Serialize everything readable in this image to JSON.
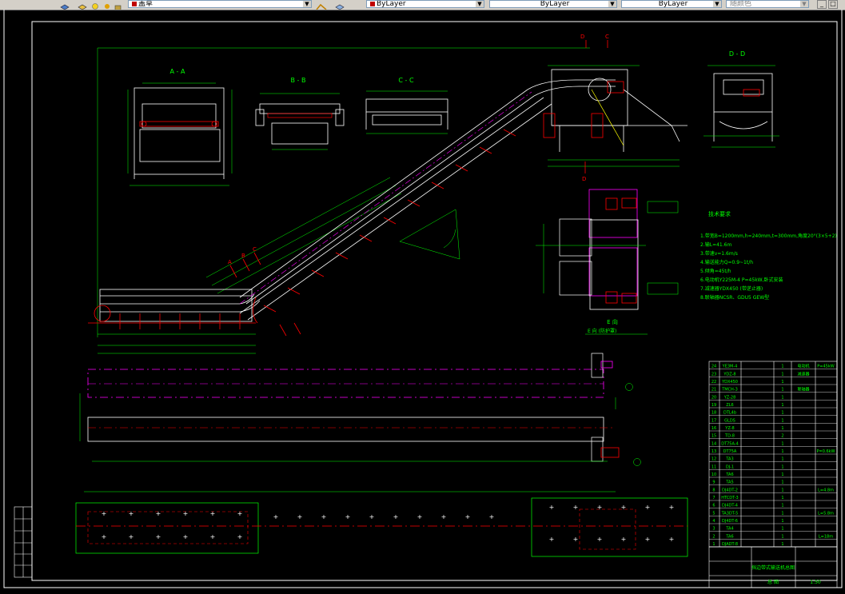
{
  "toolbar": {
    "layer_combo": "盖草",
    "color_combo": "ByLayer",
    "linetype_combo": "ByLayer",
    "lineweight_combo": "ByLayer",
    "plotstyle_combo": "随颜色"
  },
  "drawing": {
    "section_labels": {
      "aa": "A - A",
      "bb": "B - B",
      "cc": "C - C",
      "dd": "D - D",
      "e": "E 向"
    },
    "section_markers": [
      "D",
      "C",
      "D",
      "C",
      "A",
      "B",
      "C"
    ],
    "tech_title": "技术要求",
    "tech_notes": [
      "1.带宽B=1200mm,h=240mm,t=300mm,角度20°(3×5+2)",
      "2.输L=41.6m",
      "3.带速v=1.6m/s",
      "4.输送能力Q=0.9~1t/h",
      "5.倾角=45t/h",
      "6.电动机Y225M-4 P=45kW,卧式安装",
      "7.减速器YDX450 (带逆止器)",
      "8.联轴器NCSR、GDU5 GEW型"
    ],
    "e_note": "E 向 (防护罩)",
    "bom_rows": [
      [
        "24",
        "YE3M-4",
        "1",
        "电动机",
        "P=45kW"
      ],
      [
        "23",
        "YDZ-8",
        "1",
        "减速器",
        ""
      ],
      [
        "22",
        "YDX450",
        "1",
        "",
        ""
      ],
      [
        "21",
        "TMCH-3",
        "1",
        "联轴器",
        ""
      ],
      [
        "20",
        "YZ-28",
        "1",
        "",
        ""
      ],
      [
        "19",
        "ZL6",
        "1",
        "",
        ""
      ],
      [
        "18",
        "DTL4b",
        "1",
        "",
        ""
      ],
      [
        "17",
        "GLDS",
        "1",
        "",
        ""
      ],
      [
        "16",
        "YZ-8",
        "1",
        "",
        ""
      ],
      [
        "15",
        "TD-8",
        "2",
        "",
        ""
      ],
      [
        "14",
        "DT75A-4",
        "1",
        "",
        ""
      ],
      [
        "13",
        "DT75A",
        "1",
        "",
        "P=0.6kW"
      ],
      [
        "12",
        "TA3",
        "1",
        "",
        ""
      ],
      [
        "11",
        "DJ-1",
        "1",
        "",
        ""
      ],
      [
        "10",
        "TA6",
        "1",
        "",
        ""
      ],
      [
        "9",
        "TA5",
        "1",
        "",
        ""
      ],
      [
        "8",
        "DJ4DT-2",
        "1",
        "",
        "L=4.8m"
      ],
      [
        "7",
        "HTCDT-3",
        "1",
        "",
        ""
      ],
      [
        "6",
        "DJ4DT-4",
        "1",
        "",
        ""
      ],
      [
        "5",
        "TA3DT-5",
        "1",
        "",
        "L=5.8m"
      ],
      [
        "4",
        "DJ4DT-6",
        "1",
        "",
        ""
      ],
      [
        "3",
        "TA4",
        "1",
        "",
        ""
      ],
      [
        "2",
        "TA6",
        "1",
        "",
        "L=18m"
      ],
      [
        "1",
        "DJADT-8",
        "1",
        "",
        ""
      ]
    ],
    "title_block_name": "挡边带式输送机总图",
    "title_block_code": "总 图",
    "title_block_scale": "1:50"
  }
}
